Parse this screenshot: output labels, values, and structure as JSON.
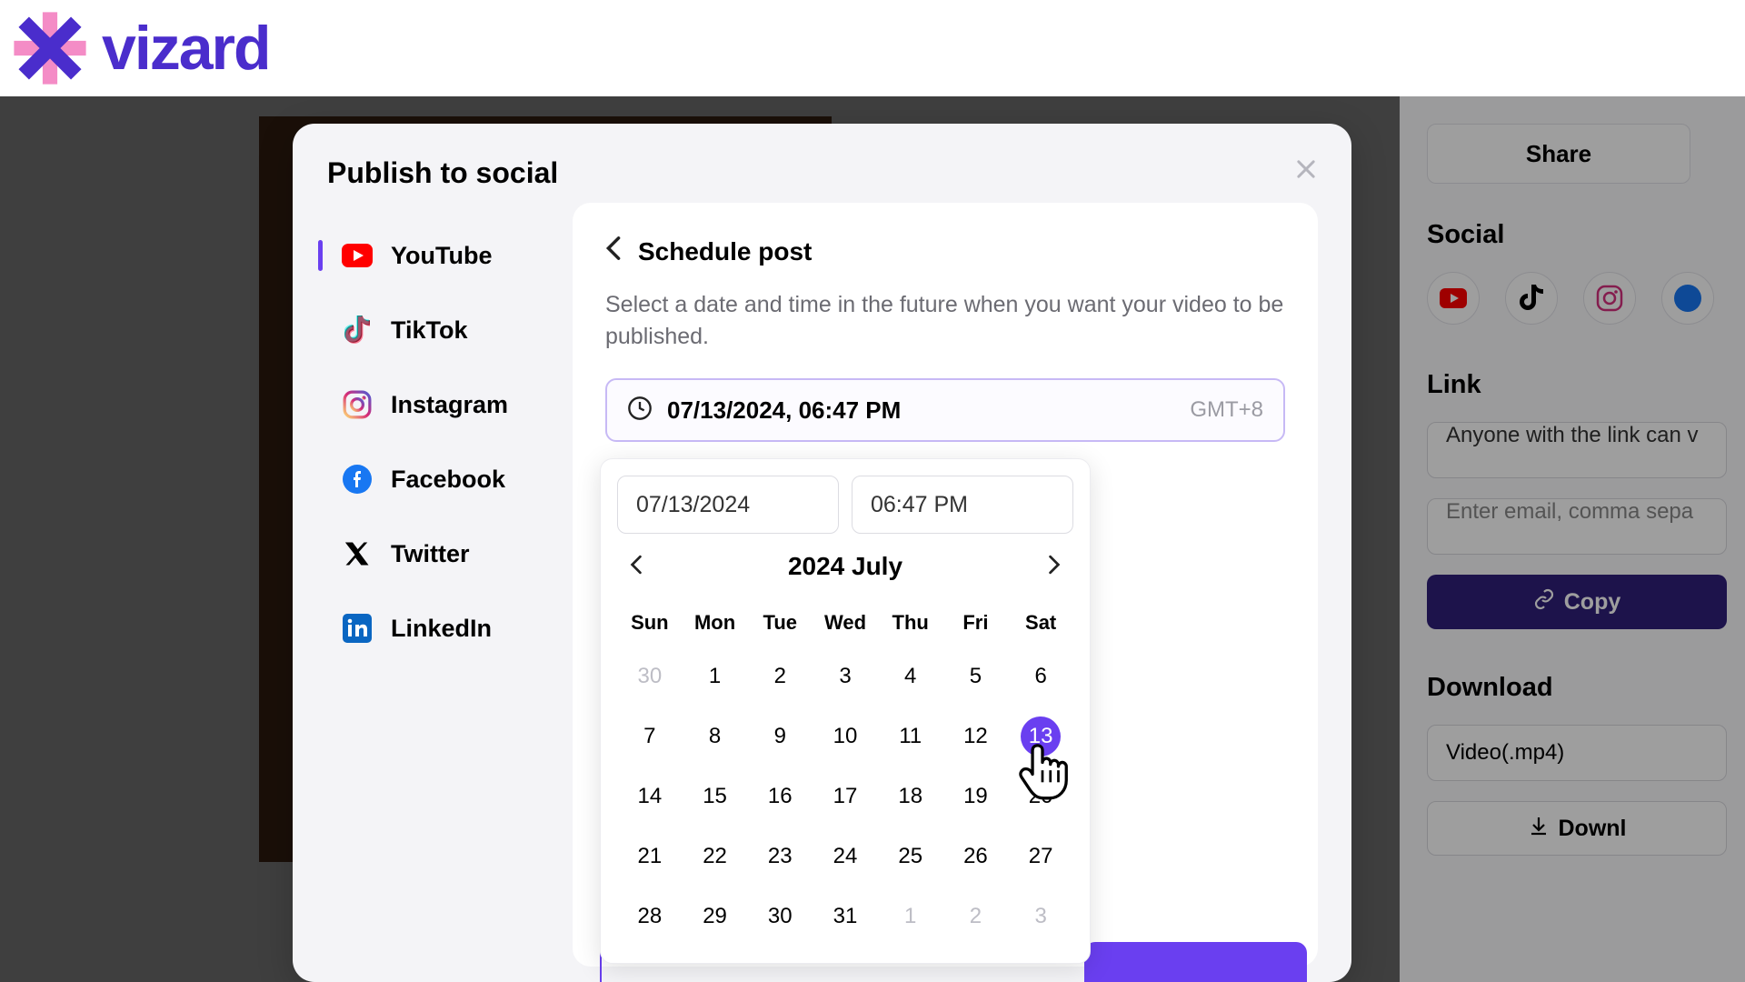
{
  "brand": "vizard",
  "modal": {
    "title": "Publish to social",
    "platforms": [
      {
        "key": "youtube",
        "label": "YouTube"
      },
      {
        "key": "tiktok",
        "label": "TikTok"
      },
      {
        "key": "instagram",
        "label": "Instagram"
      },
      {
        "key": "facebook",
        "label": "Facebook"
      },
      {
        "key": "twitter",
        "label": "Twitter"
      },
      {
        "key": "linkedin",
        "label": "LinkedIn"
      }
    ]
  },
  "schedule": {
    "title": "Schedule post",
    "description": "Select a date and time in the future when you want your video to be published.",
    "datetime_display": "07/13/2024, 06:47 PM",
    "timezone": "GMT+8",
    "date_value": "07/13/2024",
    "time_value": "06:47 PM"
  },
  "calendar": {
    "month_label": "2024 July",
    "weekdays": [
      "Sun",
      "Mon",
      "Tue",
      "Wed",
      "Thu",
      "Fri",
      "Sat"
    ],
    "rows": [
      [
        {
          "d": "30",
          "m": true
        },
        {
          "d": "1"
        },
        {
          "d": "2"
        },
        {
          "d": "3"
        },
        {
          "d": "4"
        },
        {
          "d": "5"
        },
        {
          "d": "6"
        }
      ],
      [
        {
          "d": "7"
        },
        {
          "d": "8"
        },
        {
          "d": "9"
        },
        {
          "d": "10"
        },
        {
          "d": "11"
        },
        {
          "d": "12"
        },
        {
          "d": "13",
          "sel": true
        }
      ],
      [
        {
          "d": "14"
        },
        {
          "d": "15"
        },
        {
          "d": "16"
        },
        {
          "d": "17"
        },
        {
          "d": "18"
        },
        {
          "d": "19"
        },
        {
          "d": "20"
        }
      ],
      [
        {
          "d": "21"
        },
        {
          "d": "22"
        },
        {
          "d": "23"
        },
        {
          "d": "24"
        },
        {
          "d": "25"
        },
        {
          "d": "26"
        },
        {
          "d": "27"
        }
      ],
      [
        {
          "d": "28"
        },
        {
          "d": "29"
        },
        {
          "d": "30"
        },
        {
          "d": "31"
        },
        {
          "d": "1",
          "m": true
        },
        {
          "d": "2",
          "m": true
        },
        {
          "d": "3",
          "m": true
        }
      ]
    ]
  },
  "right": {
    "share": "Share",
    "social_title": "Social",
    "link_title": "Link",
    "link_select": "Anyone with the link can v",
    "email_placeholder": "Enter email, comma sepa",
    "copy": "Copy",
    "download_title": "Download",
    "video_format": "Video(.mp4)",
    "download_btn": "Downl"
  },
  "colors": {
    "accent": "#6a3ff0",
    "brand_text": "#4a2dcc"
  }
}
